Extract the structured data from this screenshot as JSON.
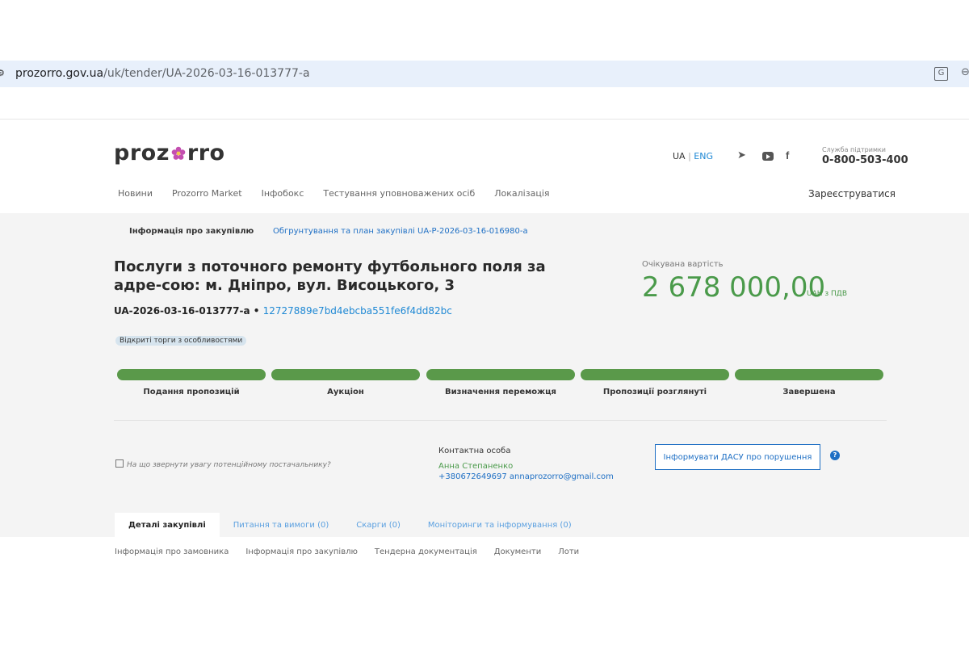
{
  "browser": {
    "url_host": "prozorro.gov.ua",
    "url_path": "/uk/tender/UA-2026-03-16-013777-a",
    "translate_icon": "translate-icon",
    "zoom_icon": "zoom-icon"
  },
  "header": {
    "logo_text_left": "proz",
    "logo_text_right": "rro",
    "lang_ua": "UA",
    "lang_sep": "|",
    "lang_eng": "ENG",
    "support_label": "Служба підтримки",
    "support_phone": "0-800-503-400",
    "nav": [
      "Новини",
      "Prozorro Market",
      "Інфобокс",
      "Тестування уповноважених осіб",
      "Локалізація"
    ],
    "register": "Зареєструватися"
  },
  "tender": {
    "subnav_active": "Інформація про закупівлю",
    "subnav_link": "Обгрунтування та план закупівлі UA-P-2026-03-16-016980-a",
    "title": "Послуги з поточного ремонту футбольного поля за адре-сою: м. Дніпро, вул. Висоцького, 3",
    "id": "UA-2026-03-16-013777-a",
    "id_sep": " • ",
    "hash": "12727889e7bd4ebcba551fe6f4dd82bc",
    "procedure_badge": "Відкриті торги з особливостями",
    "expected_value_label": "Очікувана вартість",
    "expected_value": "2 678 000,00",
    "currency": "UAH з ПДВ",
    "stages": [
      "Подання пропозицій",
      "Аукціон",
      "Визначення переможця",
      "Пропозиції розглянуті",
      "Завершена"
    ],
    "hint": "На що звернути увагу потенційному постачальнику?",
    "contact_label": "Контактна особа",
    "contact_name": "Анна Степаненко",
    "contact_details": "+380672649697 annaprozorro@gmail.com",
    "dasu_button": "Інформувати ДАСУ про порушення",
    "help": "?"
  },
  "tabs": [
    "Деталі закупівлі",
    "Питання та вимоги (0)",
    "Скарги (0)",
    "Моніторинги та інформування (0)"
  ],
  "section_links": [
    "Інформація про замовника",
    "Інформація про закупівлю",
    "Тендерна документація",
    "Документи",
    "Лоти"
  ],
  "colors": {
    "accent_blue": "#1e6fc4",
    "stage_green": "#5a994a",
    "value_green": "#4a9a4a",
    "logo_flower": "#c44fb0"
  }
}
